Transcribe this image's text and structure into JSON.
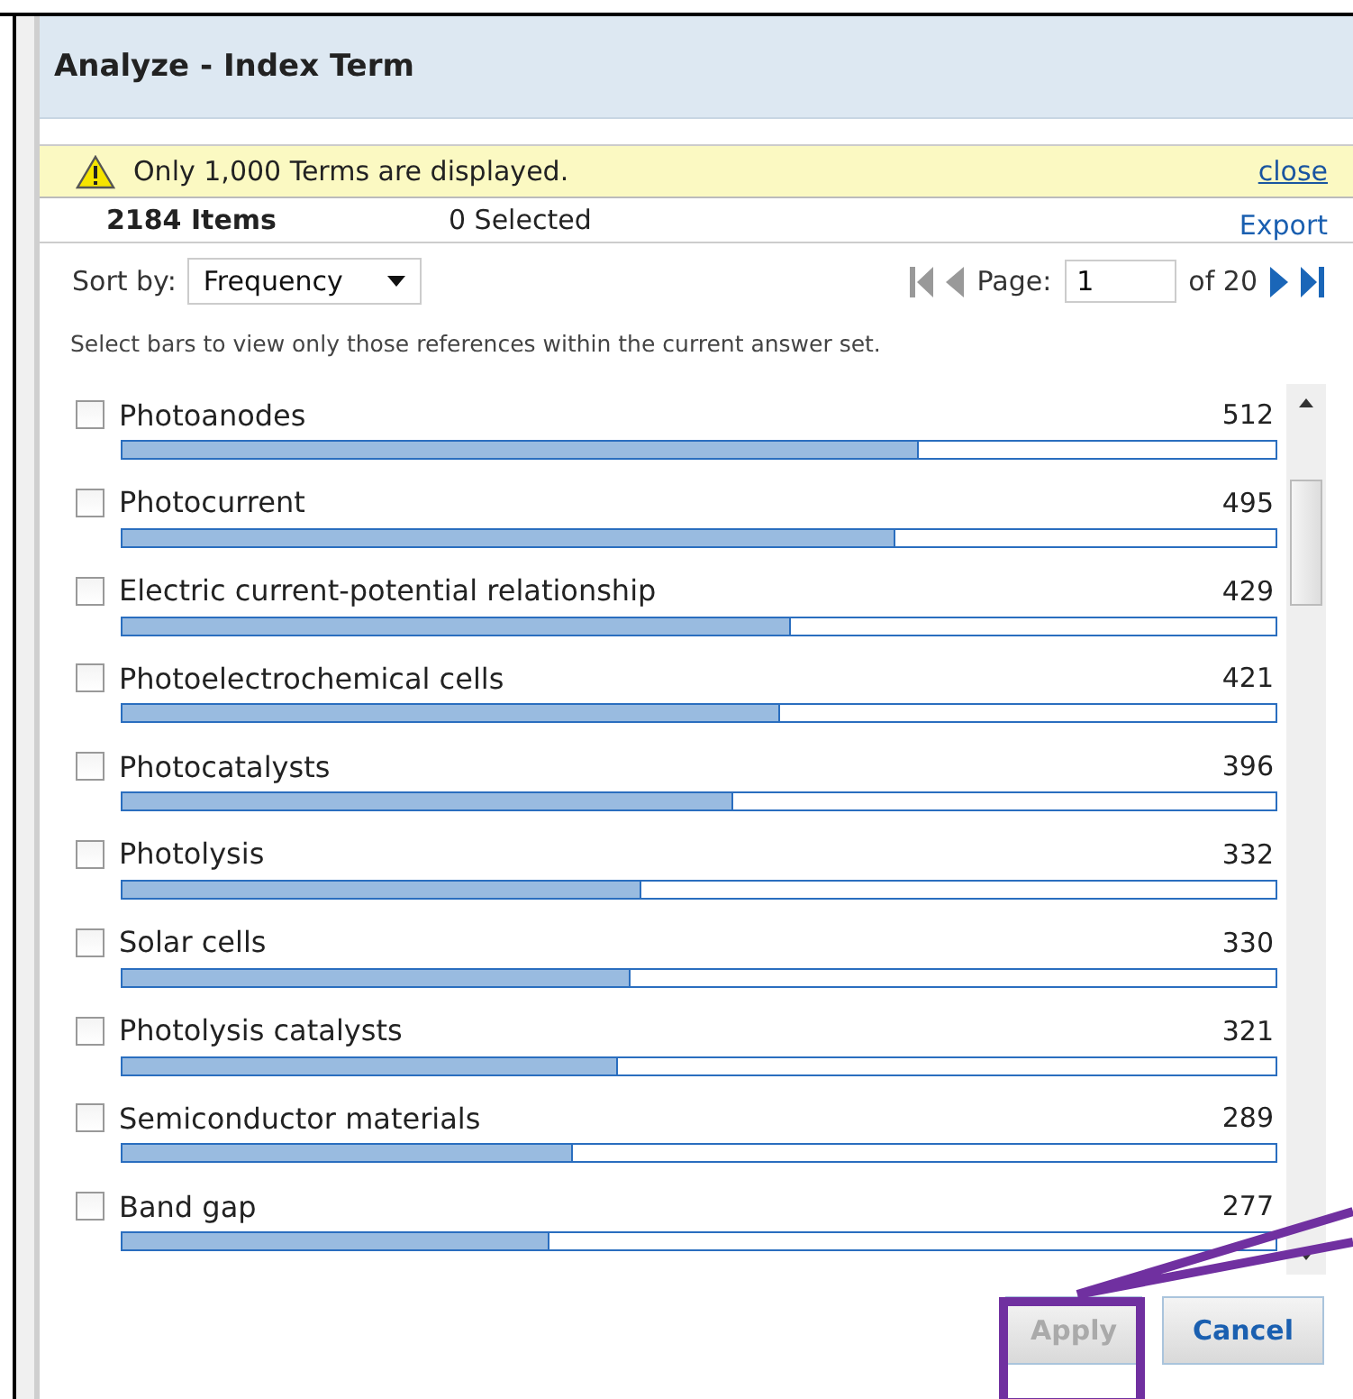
{
  "dialog": {
    "title": "Analyze - Index Term"
  },
  "notice": {
    "text": "Only 1,000 Terms are displayed.",
    "close": "close"
  },
  "summary": {
    "items": "2184 Items",
    "selected": "0 Selected",
    "export": "Export"
  },
  "sort": {
    "label": "Sort by:",
    "value": "Frequency"
  },
  "pager": {
    "label": "Page:",
    "page": "1",
    "of": "of 20"
  },
  "hint": "Select bars to view only those references within the current answer set.",
  "terms": [
    {
      "name": "Photoanodes",
      "count": "512",
      "level": 0.69,
      "checked": false
    },
    {
      "name": "Photocurrent",
      "count": "495",
      "level": 0.67,
      "checked": false
    },
    {
      "name": "Electric current-potential relationship",
      "count": "429",
      "level": 0.58,
      "checked": false
    },
    {
      "name": "Photoelectrochemical cells",
      "count": "421",
      "level": 0.57,
      "checked": false
    },
    {
      "name": "Photocatalysts",
      "count": "396",
      "level": 0.53,
      "checked": false
    },
    {
      "name": "Photolysis",
      "count": "332",
      "level": 0.45,
      "checked": false
    },
    {
      "name": "Solar cells",
      "count": "330",
      "level": 0.44,
      "checked": false
    },
    {
      "name": "Photolysis catalysts",
      "count": "321",
      "level": 0.43,
      "checked": false
    },
    {
      "name": "Semiconductor materials",
      "count": "289",
      "level": 0.39,
      "checked": false
    },
    {
      "name": "Band gap",
      "count": "277",
      "level": 0.37,
      "checked": false
    }
  ],
  "buttons": [
    {
      "label": "Apply",
      "disabled": true
    },
    {
      "label": "Cancel",
      "disabled": false
    }
  ]
}
